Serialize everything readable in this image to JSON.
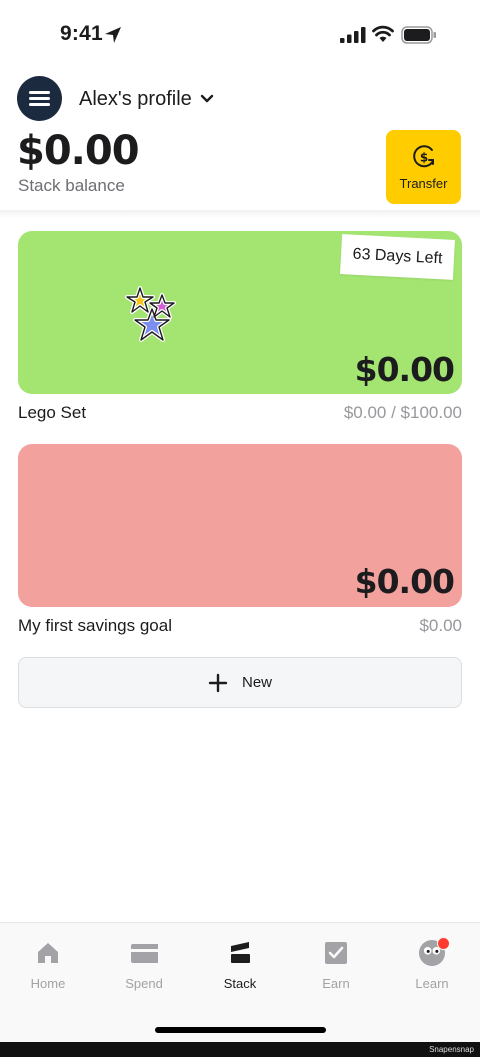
{
  "status_bar": {
    "time": "9:41"
  },
  "header": {
    "profile_name": "Alex's profile",
    "balance": "$0.00",
    "balance_label": "Stack balance",
    "transfer_label": "Transfer"
  },
  "goals": [
    {
      "name": "Lego Set",
      "amount": "$0.00",
      "progress": "$0.00 / $100.00",
      "days_left": "63 Days Left",
      "color": "#a4e572"
    },
    {
      "name": "My first savings goal",
      "amount": "$0.00",
      "progress": "$0.00",
      "color": "#f3a19d"
    }
  ],
  "new_button_label": "New",
  "tabs": [
    {
      "label": "Home",
      "icon": "home-icon"
    },
    {
      "label": "Spend",
      "icon": "card-icon"
    },
    {
      "label": "Stack",
      "icon": "stack-icon",
      "active": true
    },
    {
      "label": "Earn",
      "icon": "checkbox-icon"
    },
    {
      "label": "Learn",
      "icon": "face-icon"
    }
  ],
  "accent": "#ffcc00",
  "watermark": "Snapensnap"
}
